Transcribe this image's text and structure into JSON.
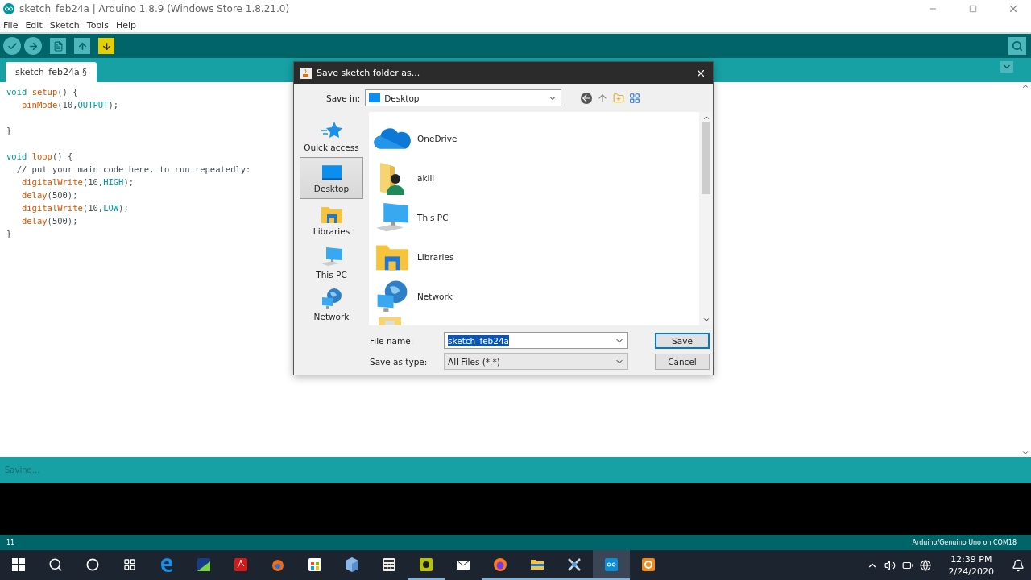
{
  "window": {
    "title": "sketch_feb24a | Arduino 1.8.9 (Windows Store 1.8.21.0)"
  },
  "menu": [
    "File",
    "Edit",
    "Sketch",
    "Tools",
    "Help"
  ],
  "toolbar": [
    {
      "kind": "verify",
      "highlighted": false
    },
    {
      "kind": "upload",
      "highlighted": false
    },
    {
      "kind": "new",
      "highlighted": false
    },
    {
      "kind": "open",
      "highlighted": false
    },
    {
      "kind": "save",
      "highlighted": true
    }
  ],
  "tabs": [
    {
      "label": "sketch_feb24a §",
      "selected": true
    }
  ],
  "code_blocks": [
    [
      "void setup() {",
      "   pinMode(10,OUTPUT);"
    ],
    [
      "}"
    ],
    [
      "void loop() {",
      "  // put your main code here, to run repeatedly:",
      "   digitalWrite(10,HIGH);",
      "   delay(500);",
      "   digitalWrite(10,LOW);",
      "   delay(500);",
      "}"
    ]
  ],
  "status_message": "Saving...",
  "bottom_bar": {
    "line": "11",
    "board": "Arduino/Genuino Uno on COM18"
  },
  "dialog": {
    "title": "Save sketch folder as...",
    "save_in": {
      "label": "Save in:",
      "value": "Desktop"
    },
    "places": [
      {
        "label": "Quick access",
        "kind": "star",
        "selected": false
      },
      {
        "label": "Desktop",
        "kind": "desktop",
        "selected": true
      },
      {
        "label": "Libraries",
        "kind": "library",
        "selected": false
      },
      {
        "label": "This PC",
        "kind": "pc",
        "selected": false
      },
      {
        "label": "Network",
        "kind": "network",
        "selected": false
      }
    ],
    "files": [
      {
        "name": "OneDrive",
        "kind": "cloud"
      },
      {
        "name": "aklil",
        "kind": "user"
      },
      {
        "name": "This PC",
        "kind": "pc"
      },
      {
        "name": "Libraries",
        "kind": "library"
      },
      {
        "name": "Network",
        "kind": "network"
      },
      {
        "kind": "folder"
      }
    ],
    "file_name": {
      "label": "File name:",
      "value": "sketch_feb24a"
    },
    "file_type": {
      "label": "Save as type:",
      "value": "All Files (*.*)"
    },
    "buttons": [
      {
        "label": "Save",
        "default": true
      },
      {
        "label": "Cancel",
        "default": false
      }
    ]
  },
  "taskbar": {
    "apps": [
      {
        "kind": "browser",
        "running": false,
        "selected": false
      },
      {
        "kind": "chart",
        "running": false,
        "selected": false
      },
      {
        "kind": "pdf",
        "running": false,
        "selected": false
      },
      {
        "kind": "flame",
        "running": false,
        "selected": false
      },
      {
        "kind": "store",
        "running": false,
        "selected": false
      },
      {
        "kind": "cube",
        "running": false,
        "selected": false
      },
      {
        "kind": "calculator",
        "running": false,
        "selected": false
      },
      {
        "kind": "recorder",
        "running": true,
        "selected": false
      },
      {
        "kind": "mail",
        "running": false,
        "selected": false
      },
      {
        "kind": "firefox",
        "running": true,
        "selected": false
      },
      {
        "kind": "folder",
        "running": true,
        "selected": false
      },
      {
        "kind": "tools",
        "running": true,
        "selected": false
      },
      {
        "kind": "arduino",
        "running": true,
        "selected": true
      },
      {
        "kind": "orange",
        "running": false,
        "selected": false
      }
    ],
    "time": "12:39 PM",
    "date": "2/24/2020"
  }
}
